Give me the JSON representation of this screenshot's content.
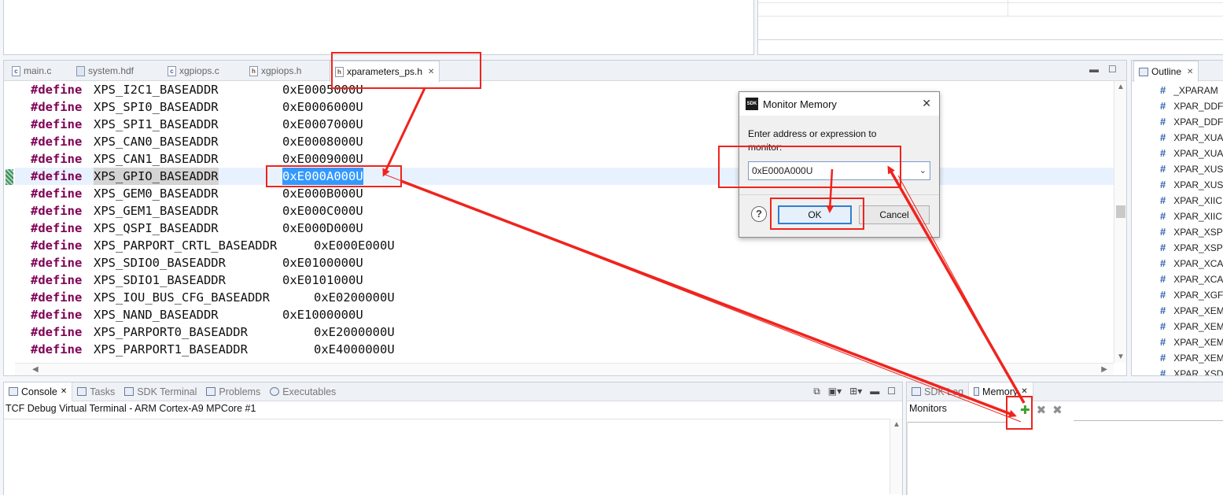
{
  "editor": {
    "tabs": [
      {
        "label": "main.c",
        "icon": "c-file-icon",
        "active": false
      },
      {
        "label": "system.hdf",
        "icon": "hdf-file-icon",
        "active": false
      },
      {
        "label": "xgpiops.c",
        "icon": "c-file-icon",
        "active": false
      },
      {
        "label": "xgpiops.h",
        "icon": "h-file-icon",
        "active": false
      },
      {
        "label": "xparameters_ps.h",
        "icon": "h-file-icon",
        "active": true
      }
    ],
    "lines": [
      {
        "kw": "#define",
        "name": "XPS_I2C1_BASEADDR",
        "value": "0xE0005000U"
      },
      {
        "kw": "#define",
        "name": "XPS_SPI0_BASEADDR",
        "value": "0xE0006000U"
      },
      {
        "kw": "#define",
        "name": "XPS_SPI1_BASEADDR",
        "value": "0xE0007000U"
      },
      {
        "kw": "#define",
        "name": "XPS_CAN0_BASEADDR",
        "value": "0xE0008000U"
      },
      {
        "kw": "#define",
        "name": "XPS_CAN1_BASEADDR",
        "value": "0xE0009000U"
      },
      {
        "kw": "#define",
        "name": "XPS_GPIO_BASEADDR",
        "value": "0xE000A000U"
      },
      {
        "kw": "#define",
        "name": "XPS_GEM0_BASEADDR",
        "value": "0xE000B000U"
      },
      {
        "kw": "#define",
        "name": "XPS_GEM1_BASEADDR",
        "value": "0xE000C000U"
      },
      {
        "kw": "#define",
        "name": "XPS_QSPI_BASEADDR",
        "value": "0xE000D000U"
      },
      {
        "kw": "#define",
        "name": "XPS_PARPORT_CRTL_BASEADDR",
        "value": "0xE000E000U"
      },
      {
        "kw": "#define",
        "name": "XPS_SDIO0_BASEADDR",
        "value": "0xE0100000U"
      },
      {
        "kw": "#define",
        "name": "XPS_SDIO1_BASEADDR",
        "value": "0xE0101000U"
      },
      {
        "kw": "#define",
        "name": "XPS_IOU_BUS_CFG_BASEADDR",
        "value": "0xE0200000U"
      },
      {
        "kw": "#define",
        "name": "XPS_NAND_BASEADDR",
        "value": "0xE1000000U"
      },
      {
        "kw": "#define",
        "name": "XPS_PARPORT0_BASEADDR",
        "value": "0xE2000000U"
      },
      {
        "kw": "#define",
        "name": "XPS_PARPORT1_BASEADDR",
        "value": "0xE4000000U"
      }
    ],
    "current_line": 5,
    "selected_value": "0xE000A000U"
  },
  "outline": {
    "title": "Outline",
    "items": [
      "_XPARAM",
      "XPAR_DDF",
      "XPAR_DDF",
      "XPAR_XUA",
      "XPAR_XUA",
      "XPAR_XUS",
      "XPAR_XUS",
      "XPAR_XIIC",
      "XPAR_XIIC",
      "XPAR_XSP",
      "XPAR_XSP",
      "XPAR_XCA",
      "XPAR_XCA",
      "XPAR_XGF",
      "XPAR_XEM",
      "XPAR_XEM",
      "XPAR_XEM",
      "XPAR_XEM",
      "XPAR_XSD"
    ]
  },
  "console": {
    "tabs": [
      {
        "label": "Console",
        "active": true
      },
      {
        "label": "Tasks",
        "active": false
      },
      {
        "label": "SDK Terminal",
        "active": false
      },
      {
        "label": "Problems",
        "active": false
      },
      {
        "label": "Executables",
        "active": false
      }
    ],
    "title": "TCF Debug Virtual Terminal - ARM Cortex-A9 MPCore #1"
  },
  "memory": {
    "tabs": [
      {
        "label": "SDK Log",
        "active": false
      },
      {
        "label": "Memory",
        "active": true
      }
    ],
    "monitors_label": "Monitors"
  },
  "dialog": {
    "title": "Monitor Memory",
    "icon_text": "SDK",
    "prompt": "Enter address or expression to monitor:",
    "address_value": "0xE000A000U",
    "ok_label": "OK",
    "cancel_label": "Cancel"
  },
  "colors": {
    "annotation": "#f0231d",
    "keyword": "#7f0055",
    "selection": "#3399ff"
  }
}
